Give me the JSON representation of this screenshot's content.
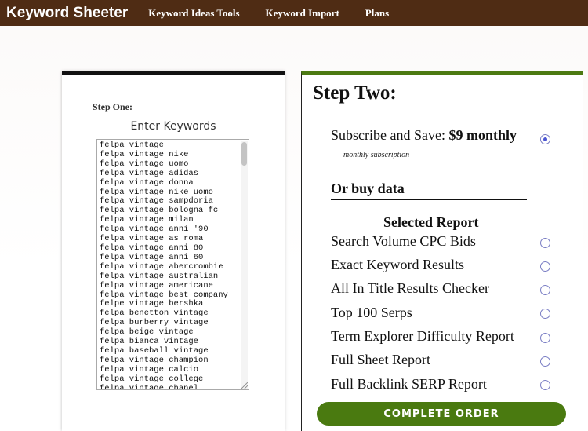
{
  "header": {
    "brand": "Keyword Sheeter",
    "nav": [
      "Keyword Ideas Tools",
      "Keyword Import",
      "Plans"
    ]
  },
  "step_one": {
    "label": "Step One:",
    "heading": "Enter Keywords",
    "keywords": [
      "felpa vintage",
      "felpa vintage nike",
      "felpa vintage uomo",
      "felpa vintage adidas",
      "felpa vintage donna",
      "felpa vintage nike uomo",
      "felpa vintage sampdoria",
      "felpa vintage bologna fc",
      "felpa vintage milan",
      "felpa vintage anni '90",
      "felpa vintage as roma",
      "felpa vintage anni 80",
      "felpa vintage anni 60",
      "felpa vintage abercrombie",
      "felpa vintage australian",
      "felpa vintage americane",
      "felpa vintage best company",
      "felpe vintage bershka",
      "felpa benetton vintage",
      "felpa burberry vintage",
      "felpa beige vintage",
      "felpa bianca vintage",
      "felpa baseball vintage",
      "felpa vintage champion",
      "felpa vintage calcio",
      "felpa vintage college",
      "felpa vintage chanel"
    ]
  },
  "step_two": {
    "title": "Step Two:",
    "subscribe_text": "Subscribe and Save: ",
    "subscribe_price": "$9 monthly",
    "subscribe_note": "monthly subscription",
    "buy_data": "Or buy data",
    "selected_report": "Selected Report",
    "reports": [
      "Search Volume CPC Bids",
      "Exact Keyword Results",
      "All In Title Results Checker",
      "Top 100 Serps",
      "Term Explorer Difficulty Report",
      "Full Sheet Report",
      "Full Backlink SERP Report"
    ],
    "button": "COMPLETE ORDER"
  },
  "colors": {
    "header_bg": "#4f2c14",
    "accent_green": "#4a7a10",
    "radio_selected": "#4b55d4"
  }
}
